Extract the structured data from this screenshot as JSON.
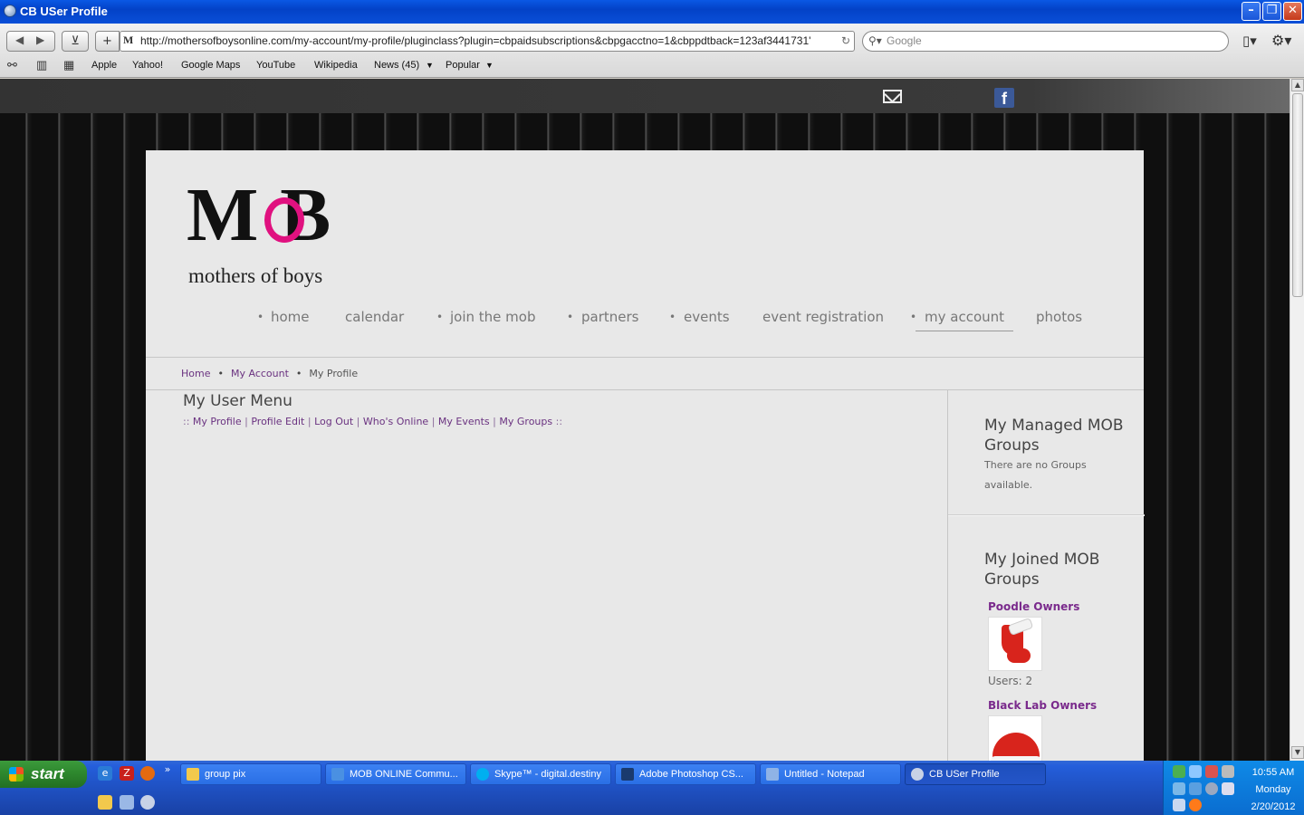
{
  "window": {
    "title": "CB USer Profile"
  },
  "toolbar": {
    "url": "http://mothersofboysonline.com/my-account/my-profile/pluginclass?plugin=cbpaidsubscriptions&cbpgacctno=1&cbppdtback=123af3441731'",
    "search_placeholder": "Google",
    "bookmarks": [
      "Apple",
      "Yahoo!",
      "Google Maps",
      "YouTube",
      "Wikipedia",
      "News (45)",
      "Popular"
    ]
  },
  "site": {
    "logo_letters": "MOB",
    "logo_tagline": "mothers of boys",
    "nav": [
      "home",
      "calendar",
      "join the mob",
      "partners",
      "events",
      "event registration",
      "my account",
      "photos"
    ],
    "breadcrumbs": [
      "Home",
      "My Account",
      "My Profile"
    ],
    "user_menu_title": "My User Menu",
    "user_menu_links": [
      "My Profile",
      "Profile Edit",
      "Log Out",
      "Who's Online",
      "My Events",
      "My Groups"
    ],
    "managed_title": "My Managed MOB Groups",
    "managed_empty": "There are no Groups available.",
    "joined_title": "My Joined MOB Groups",
    "groups": [
      {
        "name": "Poodle Owners",
        "users": "Users: 2"
      },
      {
        "name": "Black Lab Owners"
      }
    ]
  },
  "taskbar": {
    "start_label": "start",
    "tasks": [
      "group pix",
      "MOB ONLINE Commu...",
      "Skype™ - digital.destiny",
      "Adobe Photoshop CS...",
      "Untitled - Notepad",
      "CB USer Profile"
    ],
    "time": "10:55 AM",
    "day": "Monday",
    "date": "2/20/2012"
  }
}
